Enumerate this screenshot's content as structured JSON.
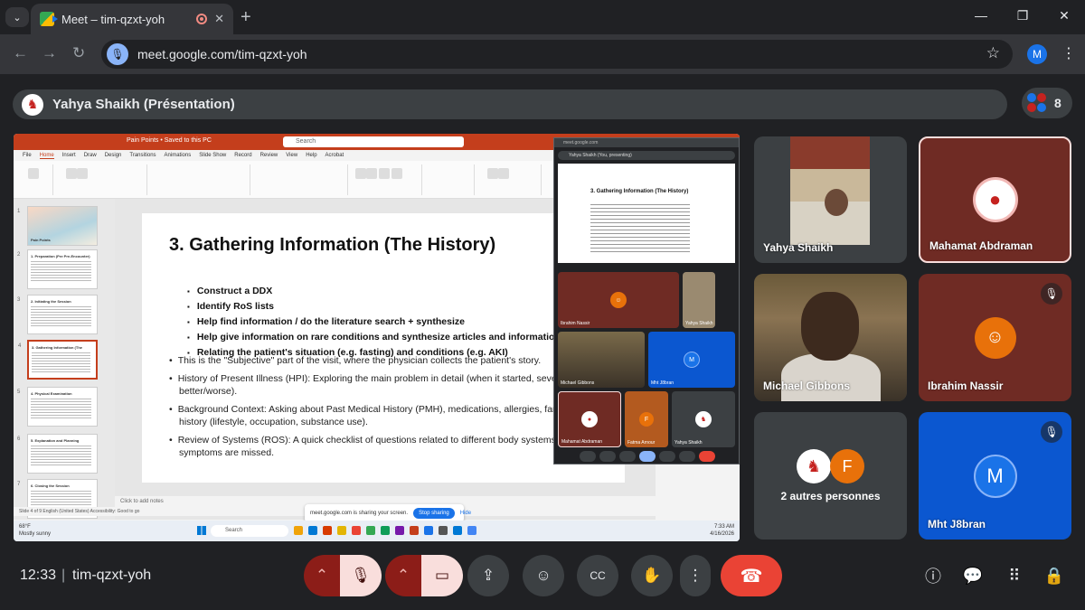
{
  "browser": {
    "tab_title": "Meet – tim-qzxt-yoh",
    "url": "meet.google.com/tim-qzxt-yoh",
    "profile_initial": "M"
  },
  "meet": {
    "presenter_label": "Yahya Shaikh (Présentation)",
    "participant_count": "8",
    "meeting_time": "12:33",
    "meeting_code": "tim-qzxt-yoh"
  },
  "shared_screen": {
    "ppt_tabs": [
      "File",
      "Home",
      "Insert",
      "Draw",
      "Design",
      "Transitions",
      "Animations",
      "Slide Show",
      "Record",
      "Review",
      "View",
      "Help",
      "Acrobat"
    ],
    "file_name": "Pain Points • Saved to this PC",
    "search_placeholder": "Search",
    "thumbnail_labels": [
      "Pain Points",
      "1. Preparation (Pre Pre-Encounter)",
      "2. Initiating the Session",
      "3. Gathering Information (The History)",
      "4. Physical Examination",
      "5. Explanation and Planning (Assessment & Plan)",
      "6. Closing the Session"
    ],
    "slide": {
      "title": "3. Gathering Information (The History)",
      "bold_bullets": [
        "Construct a DDX",
        "Identify RoS lists",
        "Help find information / do the literature search + synthesize",
        "Help give information on rare conditions and synthesize articles and information",
        "Relating the patient's situation (e.g. fasting) and conditions (e.g. AKI)"
      ],
      "bullets": [
        "This is the \"Subjective\" part of the visit, where the physician collects the patient's story.",
        "History of Present Illness (HPI): Exploring the main problem in detail (when it started, severity, what makes it better/worse).",
        "Background Context: Asking about Past Medical History (PMH), medications, allergies, family history, and social history (lifestyle, occupation, substance use).",
        "Review of Systems (ROS): A quick checklist of questions related to different body systems to ensure no related symptoms are missed."
      ]
    },
    "notes_placeholder": "Click to add notes",
    "status_text": "Slide 4 of 9    English (United States)    Accessibility: Good to go",
    "share_notice": "meet.google.com is sharing your screen.",
    "stop_sharing": "Stop sharing",
    "hide": "Hide",
    "weather": "68°F\nMostly sunny",
    "taskbar_search": "Search",
    "tray_time": "7:33 AM",
    "tray_date": "4/16/2026",
    "float": {
      "domain": "meet.google.com",
      "presenter": "Yahya Shaikh (You, presenting)",
      "tiles": [
        "Ibrahim Nassir",
        "Yahya Shaikh",
        "Michael Gibbons",
        "Mht J8bran",
        "Mahamat Abdraman",
        "Fatma Arnour",
        "Yahya Shaikh"
      ]
    }
  },
  "participants": {
    "yahya": "Yahya Shaikh",
    "mahamat": "Mahamat Abdraman",
    "michael": "Michael Gibbons",
    "ibrahim": "Ibrahim Nassir",
    "others": "2 autres personnes",
    "others_initial": "F",
    "mht": "Mht J8bran",
    "mht_initial": "M"
  },
  "colors": {
    "accent_red": "#ea4335",
    "mic_off_dark": "#8c1d18",
    "mic_off_light": "#f9dedc",
    "avatar_blue": "#1a73e8",
    "avatar_orange": "#e8710a"
  }
}
